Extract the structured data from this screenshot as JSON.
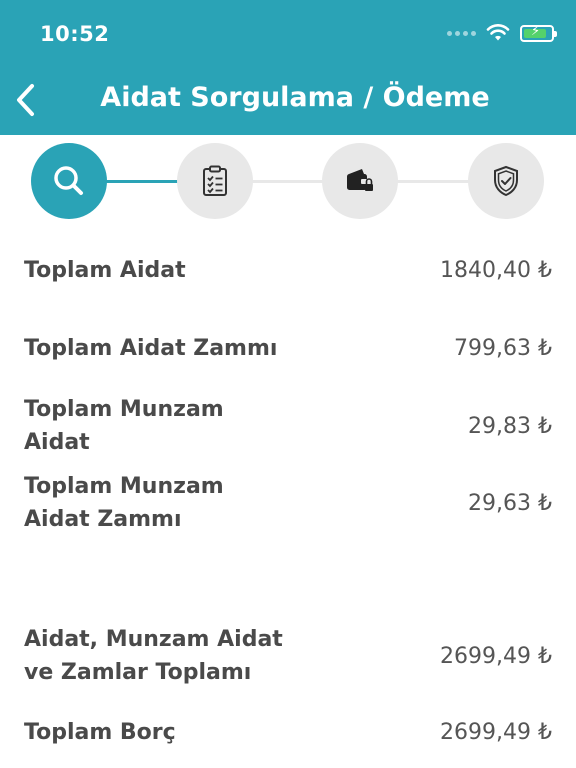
{
  "status_bar": {
    "time": "10:52"
  },
  "header": {
    "title": "Aidat Sorgulama / Ödeme"
  },
  "stepper": {
    "steps": [
      {
        "icon": "search-icon",
        "active": true
      },
      {
        "icon": "clipboard-checklist-icon",
        "active": false
      },
      {
        "icon": "wallet-lock-icon",
        "active": false
      },
      {
        "icon": "shield-check-icon",
        "active": false
      }
    ],
    "colors": {
      "active": "#2aa3b6",
      "inactive": "#e8e8e8"
    }
  },
  "rows": [
    {
      "label": "Toplam Aidat",
      "value": "1840,40 ₺"
    },
    {
      "label": "Toplam Aidat Zammı",
      "value": "799,63 ₺"
    },
    {
      "label": "Toplam Munzam Aidat",
      "value": "29,83 ₺"
    },
    {
      "label": "Toplam Munzam Aidat Zammı",
      "value": "29,63 ₺"
    },
    {
      "label": "Aidat, Munzam Aidat ve Zamlar Toplamı",
      "value": "2699,49 ₺"
    },
    {
      "label": "Toplam Borç",
      "value": "2699,49 ₺"
    }
  ]
}
